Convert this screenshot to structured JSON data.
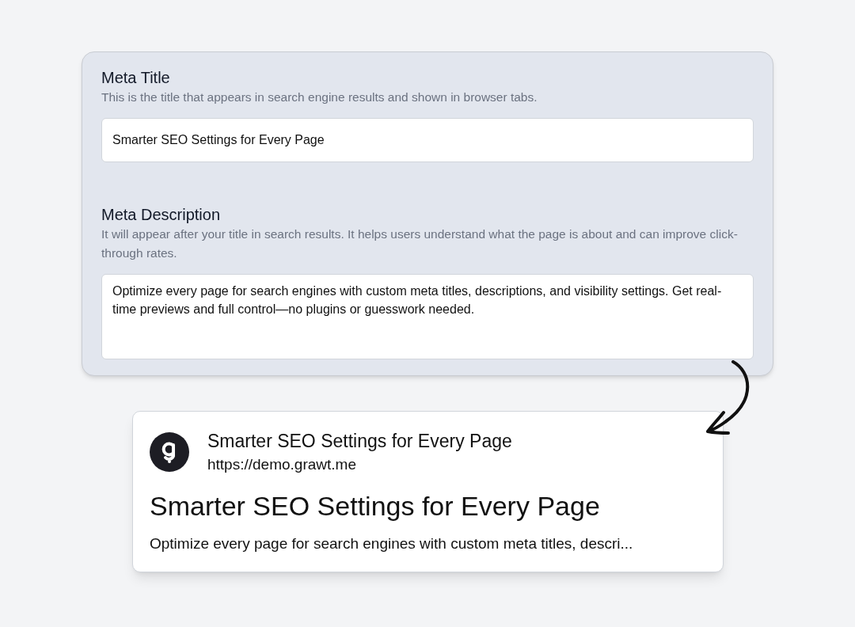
{
  "form": {
    "fields": [
      {
        "kind": "input",
        "label": "Meta Title",
        "help": "This is the title that appears in search engine results and shown in browser tabs.",
        "value": "Smarter SEO Settings for Every Page"
      },
      {
        "kind": "textarea",
        "label": "Meta Description",
        "help": "It will appear after your title in search results. It helps users understand what the page is about and can improve click-through rates.",
        "value": "Optimize every page for search engines with custom meta titles, descriptions, and visibility settings. Get real-time previews and full control—no plugins or guesswork needed."
      }
    ]
  },
  "preview": {
    "site_name": "Smarter SEO Settings for Every Page",
    "url": "https://demo.grawt.me",
    "title": "Smarter SEO Settings for Every Page",
    "description": "Optimize every page for search engines with custom meta titles, descri..."
  }
}
